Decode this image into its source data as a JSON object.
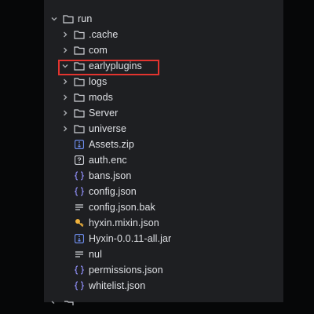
{
  "tree": {
    "root": {
      "label": "run",
      "icon": "folder-icon",
      "expanded": true
    },
    "items": [
      {
        "label": ".cache",
        "kind": "folder",
        "icon": "folder-icon",
        "expanded": false
      },
      {
        "label": "com",
        "kind": "folder",
        "icon": "folder-icon",
        "expanded": false
      },
      {
        "label": "earlyplugins",
        "kind": "folder",
        "icon": "folder-icon",
        "expanded": true,
        "highlighted": true
      },
      {
        "label": "logs",
        "kind": "folder",
        "icon": "folder-icon",
        "expanded": false
      },
      {
        "label": "mods",
        "kind": "folder",
        "icon": "folder-icon",
        "expanded": false
      },
      {
        "label": "Server",
        "kind": "folder",
        "icon": "folder-icon",
        "expanded": false
      },
      {
        "label": "universe",
        "kind": "folder",
        "icon": "folder-icon",
        "expanded": false
      },
      {
        "label": "Assets.zip",
        "kind": "file",
        "icon": "archive-file-icon"
      },
      {
        "label": "auth.enc",
        "kind": "file",
        "icon": "unknown-file-icon"
      },
      {
        "label": "bans.json",
        "kind": "file",
        "icon": "json-file-icon"
      },
      {
        "label": "config.json",
        "kind": "file",
        "icon": "json-file-icon"
      },
      {
        "label": "config.json.bak",
        "kind": "file",
        "icon": "text-file-icon"
      },
      {
        "label": "hyxin.mixin.json",
        "kind": "file",
        "icon": "mixin-file-icon"
      },
      {
        "label": "Hyxin-0.0.11-all.jar",
        "kind": "file",
        "icon": "archive-file-icon"
      },
      {
        "label": "nul",
        "kind": "file",
        "icon": "text-file-icon"
      },
      {
        "label": "permissions.json",
        "kind": "file",
        "icon": "json-file-icon"
      },
      {
        "label": "whitelist.json",
        "kind": "file",
        "icon": "json-file-icon"
      }
    ]
  },
  "colors": {
    "background": "#060708",
    "panel": "#1e1f22",
    "text": "#dfe1e5",
    "icon": "#ced0d6",
    "chevron": "#a8abb0",
    "json_icon": "#8d8cf2",
    "archive_icon": "#6f8ff0",
    "mixin_icon": "#f0b23c",
    "highlight": "#e3342f"
  }
}
